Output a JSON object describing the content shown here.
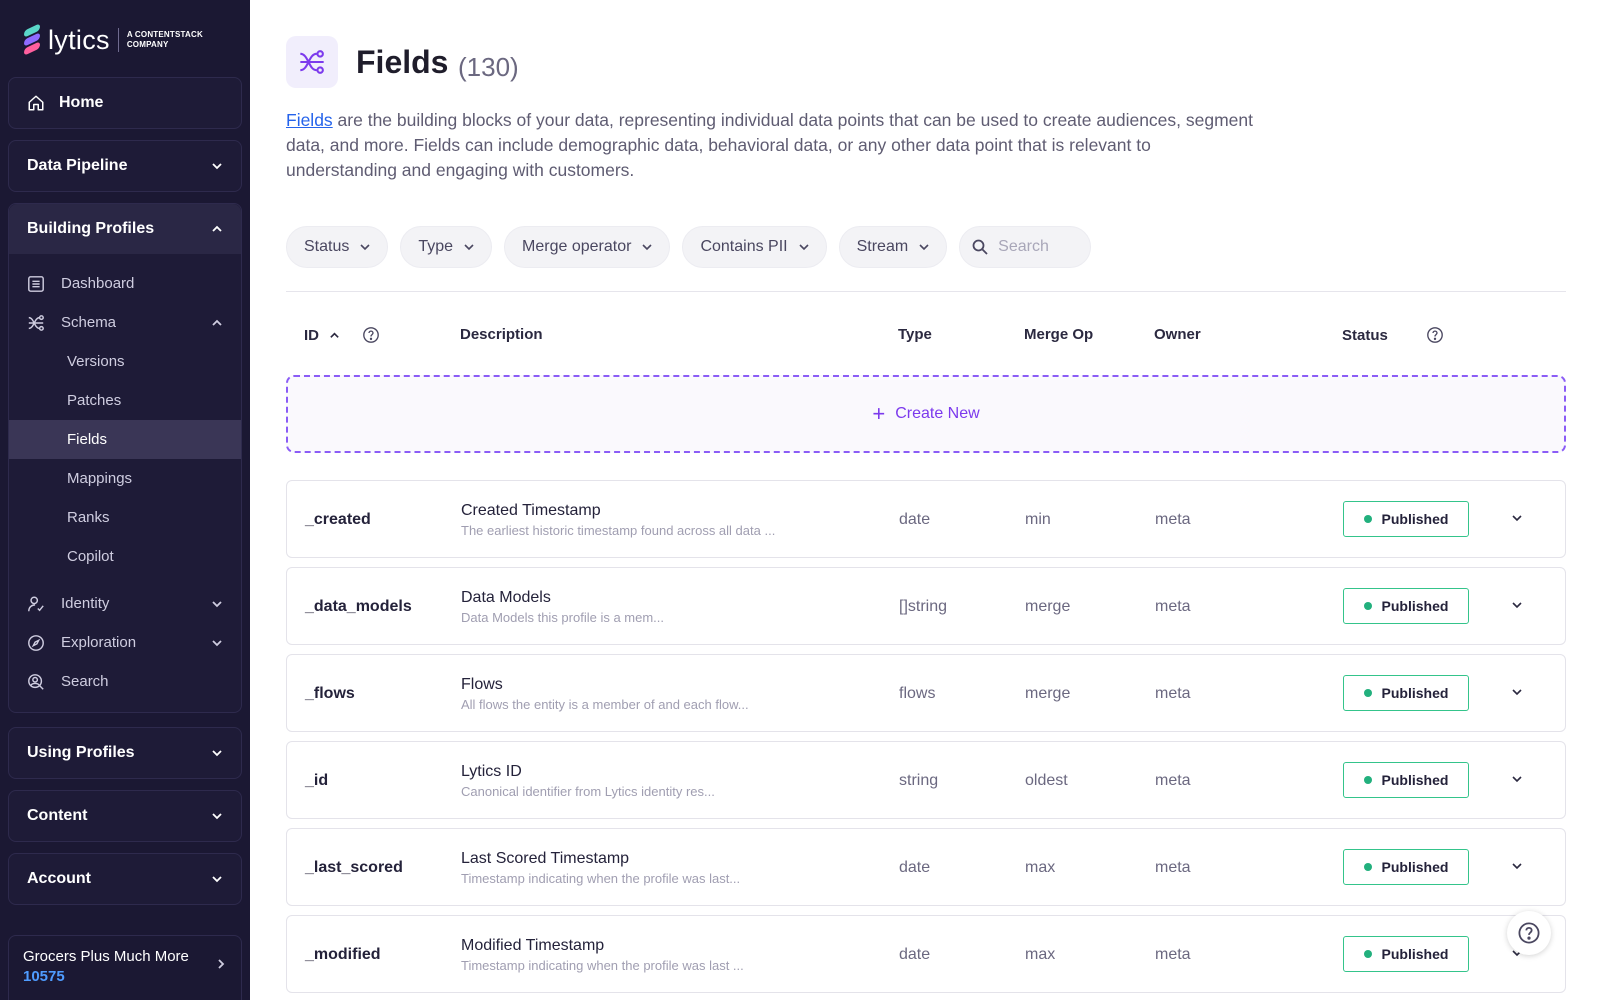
{
  "brand": {
    "name": "lytics",
    "tagline_1": "A CONTENTSTACK",
    "tagline_2": "COMPANY"
  },
  "sidebar": {
    "home": "Home",
    "data_pipeline": "Data Pipeline",
    "building_profiles": {
      "label": "Building Profiles",
      "items": {
        "dashboard": "Dashboard",
        "schema": "Schema",
        "versions": "Versions",
        "patches": "Patches",
        "fields": "Fields",
        "mappings": "Mappings",
        "ranks": "Ranks",
        "copilot": "Copilot",
        "identity": "Identity",
        "exploration": "Exploration",
        "search": "Search"
      }
    },
    "using_profiles": "Using Profiles",
    "content": "Content",
    "account": "Account",
    "account_switch": {
      "name": "Grocers Plus Much More",
      "id": "10575"
    }
  },
  "page": {
    "title": "Fields",
    "count": "(130)",
    "intro_link": "Fields",
    "intro_text": " are the building blocks of your data, representing individual data points that can be used to create audiences, segment data, and more. Fields can include demographic data, behavioral data, or any other data point that is relevant to understanding and engaging with customers."
  },
  "filters": {
    "status": "Status",
    "type": "Type",
    "merge_operator": "Merge operator",
    "contains_pii": "Contains PII",
    "stream": "Stream",
    "search_placeholder": "Search"
  },
  "table": {
    "headers": {
      "id": "ID",
      "description": "Description",
      "type": "Type",
      "merge_op": "Merge Op",
      "owner": "Owner",
      "status": "Status"
    },
    "create_new": "Create New",
    "rows": [
      {
        "id": "_created",
        "title": "Created Timestamp",
        "desc": "The earliest historic timestamp found across all data ...",
        "type": "date",
        "merge": "min",
        "owner": "meta",
        "status": "Published"
      },
      {
        "id": "_data_models",
        "title": "Data Models",
        "desc": "Data Models this profile is a mem...",
        "type": "[]string",
        "merge": "merge",
        "owner": "meta",
        "status": "Published"
      },
      {
        "id": "_flows",
        "title": "Flows",
        "desc": "All flows the entity is a member of and each flow...",
        "type": "flows",
        "merge": "merge",
        "owner": "meta",
        "status": "Published"
      },
      {
        "id": "_id",
        "title": "Lytics ID",
        "desc": "Canonical identifier from Lytics identity res...",
        "type": "string",
        "merge": "oldest",
        "owner": "meta",
        "status": "Published"
      },
      {
        "id": "_last_scored",
        "title": "Last Scored Timestamp",
        "desc": "Timestamp indicating when the profile was last...",
        "type": "date",
        "merge": "max",
        "owner": "meta",
        "status": "Published"
      },
      {
        "id": "_modified",
        "title": "Modified Timestamp",
        "desc": "Timestamp indicating when the profile was last ...",
        "type": "date",
        "merge": "max",
        "owner": "meta",
        "status": "Published"
      }
    ]
  },
  "colors": {
    "sidebar_bg": "#1b1833",
    "accent": "#7c3aed",
    "link": "#2563eb",
    "published_border": "#34c48b",
    "account_id": "#4f9cff"
  }
}
